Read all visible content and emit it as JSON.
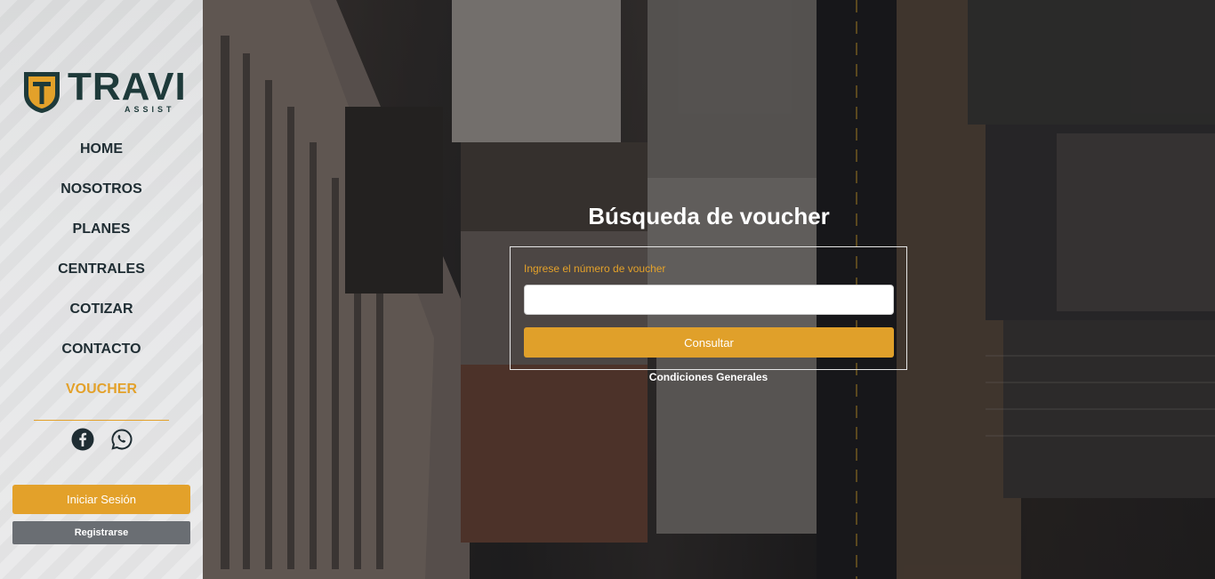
{
  "brand": {
    "name": "TRAVI",
    "sub": "ASSIST",
    "colors": {
      "accent": "#e3a12a",
      "dark": "#1e3a3a"
    }
  },
  "nav": {
    "items": [
      {
        "label": "HOME"
      },
      {
        "label": "NOSOTROS"
      },
      {
        "label": "PLANES"
      },
      {
        "label": "CENTRALES"
      },
      {
        "label": "COTIZAR"
      },
      {
        "label": "CONTACTO"
      },
      {
        "label": "VOUCHER",
        "active": true
      }
    ]
  },
  "social": {
    "icons": [
      "facebook-icon",
      "whatsapp-icon"
    ]
  },
  "auth": {
    "login_label": "Iniciar Sesión",
    "register_label": "Registrarse"
  },
  "voucher": {
    "title": "Búsqueda de voucher",
    "field_label": "Ingrese el número de voucher",
    "input_value": "",
    "submit_label": "Consultar",
    "conditions_label": "Condiciones Generales"
  }
}
